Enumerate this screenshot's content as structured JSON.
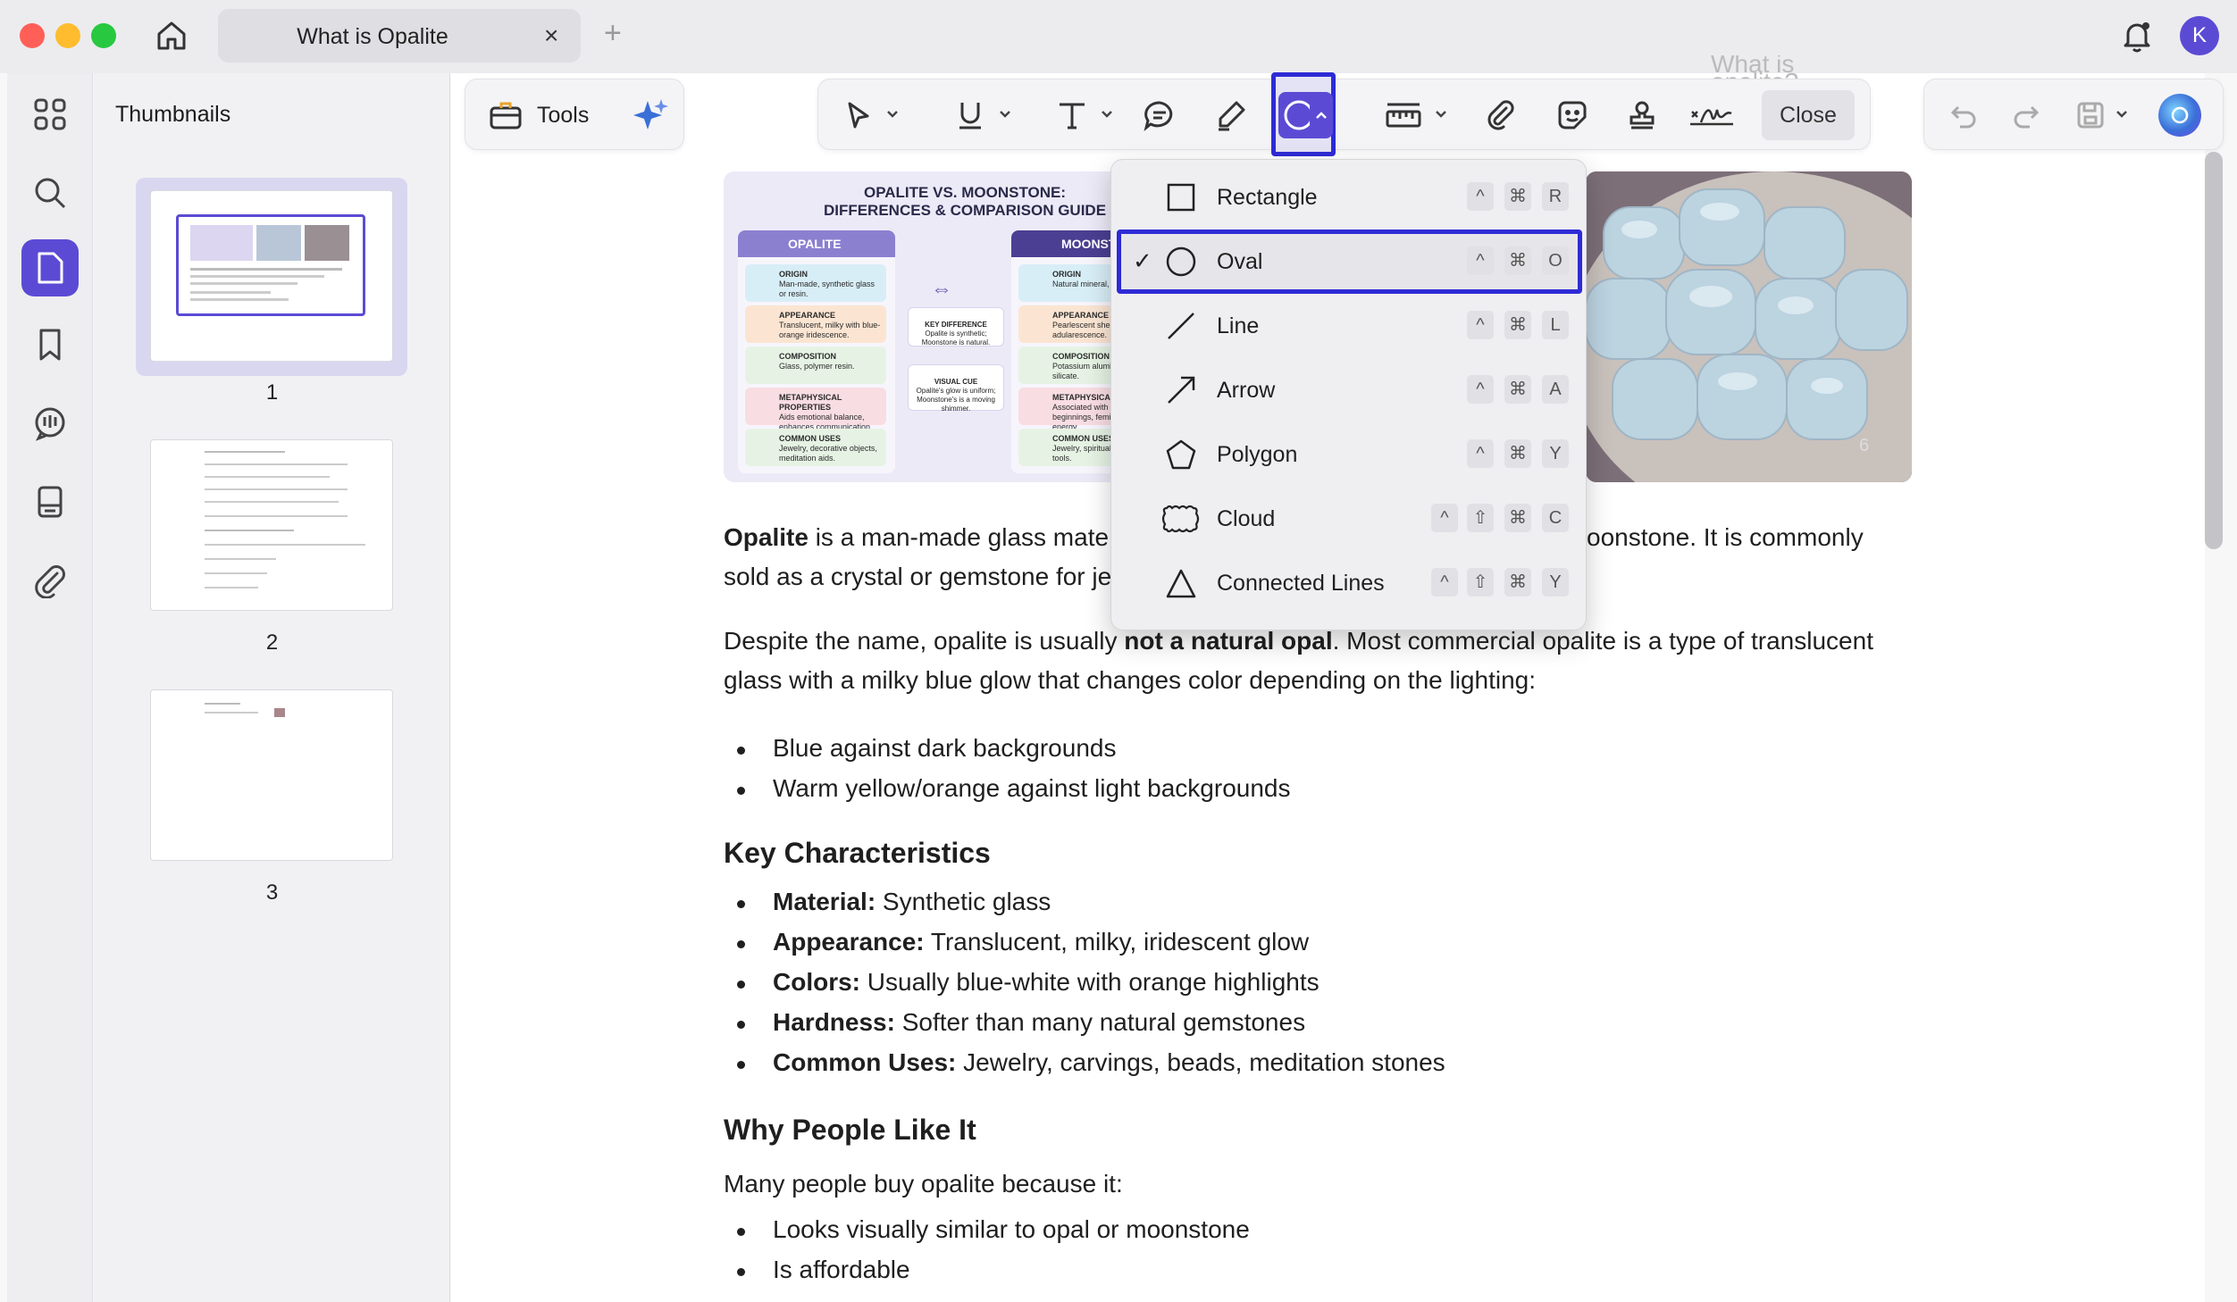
{
  "window": {
    "tab_title": "What is Opalite",
    "tab_close": "×",
    "new_tab": "+",
    "avatar_initial": "K"
  },
  "sidebar": {
    "title": "Thumbnails",
    "pages": [
      "1",
      "2",
      "3"
    ]
  },
  "toolbar": {
    "tools_label": "Tools",
    "close_label": "Close",
    "ghost_heading": "What is opalite?"
  },
  "shape_menu": {
    "items": [
      {
        "label": "Rectangle",
        "keys": [
          "^",
          "⌘",
          "R"
        ],
        "checked": false
      },
      {
        "label": "Oval",
        "keys": [
          "^",
          "⌘",
          "O"
        ],
        "checked": true
      },
      {
        "label": "Line",
        "keys": [
          "^",
          "⌘",
          "L"
        ],
        "checked": false
      },
      {
        "label": "Arrow",
        "keys": [
          "^",
          "⌘",
          "A"
        ],
        "checked": false
      },
      {
        "label": "Polygon",
        "keys": [
          "^",
          "⌘",
          "Y"
        ],
        "checked": false
      },
      {
        "label": "Cloud",
        "keys": [
          "^",
          "⇧",
          "⌘",
          "C"
        ],
        "checked": false
      },
      {
        "label": "Connected Lines",
        "keys": [
          "^",
          "⇧",
          "⌘",
          "Y"
        ],
        "checked": false
      }
    ],
    "check_mark": "✓"
  },
  "infographic": {
    "title_line1": "OPALITE VS. MOONSTONE:",
    "title_line2": "DIFFERENCES & COMPARISON GUIDE",
    "left_head": "OPALITE",
    "right_head": "MOONSTONE",
    "left_rows": [
      {
        "title": "ORIGIN",
        "text": "Man-made, synthetic glass or resin."
      },
      {
        "title": "APPEARANCE",
        "text": "Translucent, milky with blue-orange iridescence."
      },
      {
        "title": "COMPOSITION",
        "text": "Glass, polymer resin."
      },
      {
        "title": "METAPHYSICAL PROPERTIES",
        "text": "Aids emotional balance, enhances communication, soothes."
      },
      {
        "title": "COMMON USES",
        "text": "Jewelry, decorative objects, meditation aids."
      }
    ],
    "right_rows": [
      {
        "title": "ORIGIN",
        "text": "Natural mineral, feldspar."
      },
      {
        "title": "APPEARANCE",
        "text": "Pearlescent sheen, adularescence."
      },
      {
        "title": "COMPOSITION",
        "text": "Potassium aluminum silicate."
      },
      {
        "title": "METAPHYSICAL",
        "text": "Associated with new beginnings, feminine energy."
      },
      {
        "title": "COMMON USES",
        "text": "Jewelry, spiritual healing tools."
      }
    ],
    "key_difference_title": "KEY DIFFERENCE",
    "key_difference_text": "Opalite is synthetic; Moonstone is natural.",
    "visual_cue_title": "VISUAL CUE",
    "visual_cue_text": "Opalite's glow is uniform; Moonstone's is a moving shimmer."
  },
  "photo": {
    "count_badge": "6"
  },
  "content": {
    "para1_bold": "Opalite",
    "para1_line1_rest": " is a man-made glass mate",
    "para1_line1_tail": "oonstone. It is commonly",
    "para1_line2": "sold as a crystal or gemstone for je",
    "para2_pre": "Despite the name, opalite is usually ",
    "para2_bold": "not a natural opal",
    "para2_post": ". Most commercial opalite is a type of translucent",
    "para2_line2": "glass with a milky blue glow that changes color depending on the lighting:",
    "bullets1": [
      "Blue against dark backgrounds",
      "Warm yellow/orange against light backgrounds"
    ],
    "heading1": "Key Characteristics",
    "characteristics": [
      {
        "label": "Material:",
        "value": " Synthetic glass"
      },
      {
        "label": "Appearance:",
        "value": " Translucent, milky, iridescent glow"
      },
      {
        "label": "Colors:",
        "value": " Usually blue-white with orange highlights"
      },
      {
        "label": "Hardness:",
        "value": " Softer than many natural gemstones"
      },
      {
        "label": "Common Uses:",
        "value": " Jewelry, carvings, beads, meditation stones"
      }
    ],
    "heading2": "Why People Like It",
    "para3": "Many people buy opalite because it:",
    "bullets2": [
      "Looks visually similar to opal or moonstone",
      "Is affordable"
    ]
  },
  "colors": {
    "accent": "#2e2bd6",
    "sidebar_active": "#5b4bd4",
    "traffic_red": "#ff5f57",
    "traffic_yellow": "#febc2e",
    "traffic_green": "#28c840"
  }
}
